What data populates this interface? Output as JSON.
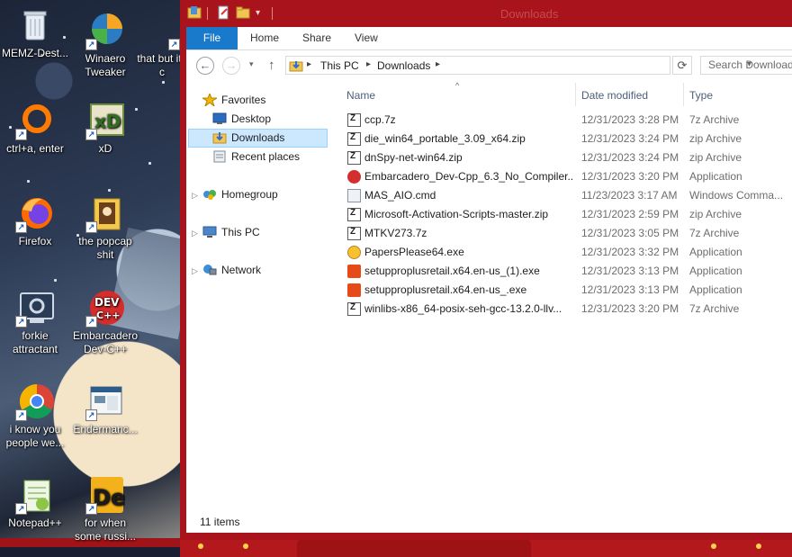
{
  "desktop": {
    "icons": [
      {
        "label": "MEMZ-Dest...",
        "icon": "recycle-bin-icon"
      },
      {
        "label": "Winaero Tweaker",
        "icon": "winaero-icon"
      },
      {
        "label": "that but its c",
        "icon": "shortcut-icon"
      },
      {
        "label": "ctrl+a, enter",
        "icon": "orange-ring-icon"
      },
      {
        "label": "xD",
        "icon": "xd-icon"
      },
      {
        "label": "Firefox",
        "icon": "firefox-icon"
      },
      {
        "label": "the popcap shit",
        "icon": "popcap-folder-icon"
      },
      {
        "label": "forkie attractant",
        "icon": "forkie-icon"
      },
      {
        "label": "Embarcadero Dev-C++",
        "icon": "devcpp-icon"
      },
      {
        "label": "i know you people we...",
        "icon": "chrome-icon"
      },
      {
        "label": "Endermanc...",
        "icon": "enderman-icon"
      },
      {
        "label": "Notepad++",
        "icon": "notepadpp-icon"
      },
      {
        "label": "for when some russi...",
        "icon": "de-icon"
      }
    ]
  },
  "window": {
    "title": "Downloads",
    "accent": "#a8131c",
    "tabs": [
      "File",
      "Home",
      "Share",
      "View"
    ],
    "address": {
      "crumbs": [
        "This PC",
        "Downloads"
      ]
    },
    "search_placeholder": "Search Downloads",
    "nav": {
      "favorites": "Favorites",
      "desktop": "Desktop",
      "downloads": "Downloads",
      "recent": "Recent places",
      "homegroup": "Homegroup",
      "thispc": "This PC",
      "network": "Network"
    },
    "columns": {
      "name": "Name",
      "date": "Date modified",
      "type": "Type"
    },
    "files": [
      {
        "name": "ccp.7z",
        "date": "12/31/2023 3:28 PM",
        "type": "7z Archive",
        "icon": "zip"
      },
      {
        "name": "die_win64_portable_3.09_x64.zip",
        "date": "12/31/2023 3:24 PM",
        "type": "zip Archive",
        "icon": "zip"
      },
      {
        "name": "dnSpy-net-win64.zip",
        "date": "12/31/2023 3:24 PM",
        "type": "zip Archive",
        "icon": "zip"
      },
      {
        "name": "Embarcadero_Dev-Cpp_6.3_No_Compiler...",
        "date": "12/31/2023 3:20 PM",
        "type": "Application",
        "icon": "dev"
      },
      {
        "name": "MAS_AIO.cmd",
        "date": "11/23/2023 3:17 AM",
        "type": "Windows Comma...",
        "icon": "cmd"
      },
      {
        "name": "Microsoft-Activation-Scripts-master.zip",
        "date": "12/31/2023 2:59 PM",
        "type": "zip Archive",
        "icon": "zip"
      },
      {
        "name": "MTKV273.7z",
        "date": "12/31/2023 3:05 PM",
        "type": "7z Archive",
        "icon": "zip"
      },
      {
        "name": "PapersPlease64.exe",
        "date": "12/31/2023 3:32 PM",
        "type": "Application",
        "icon": "app"
      },
      {
        "name": "setupproplusretail.x64.en-us_(1).exe",
        "date": "12/31/2023 3:13 PM",
        "type": "Application",
        "icon": "office"
      },
      {
        "name": "setupproplusretail.x64.en-us_.exe",
        "date": "12/31/2023 3:13 PM",
        "type": "Application",
        "icon": "office"
      },
      {
        "name": "winlibs-x86_64-posix-seh-gcc-13.2.0-llv...",
        "date": "12/31/2023 3:20 PM",
        "type": "7z Archive",
        "icon": "zip"
      }
    ],
    "status": "11 items"
  }
}
